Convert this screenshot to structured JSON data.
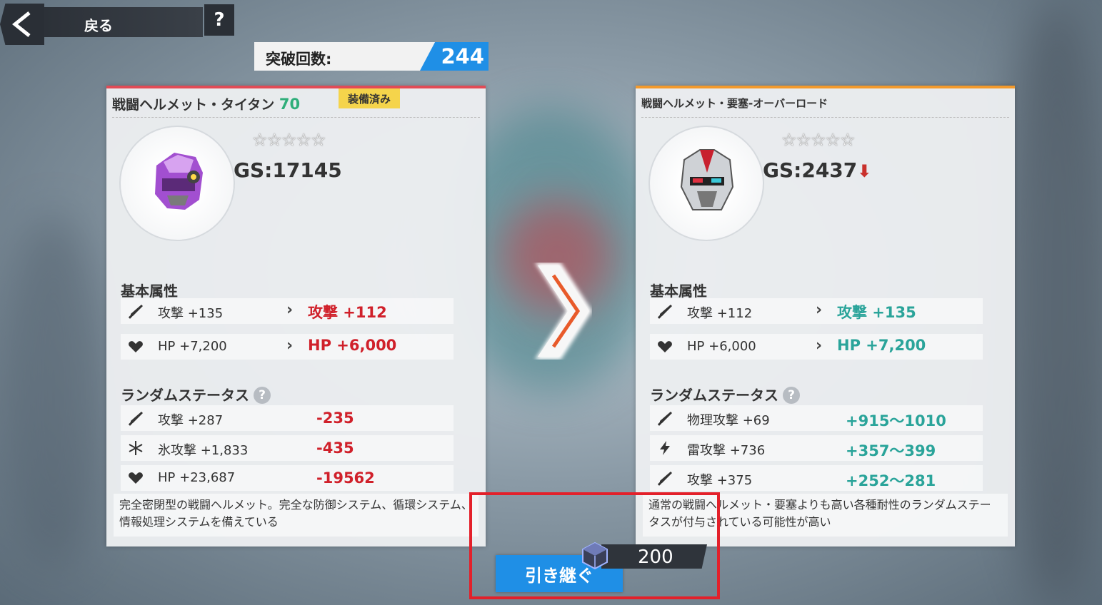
{
  "header": {
    "back_label": "戻る",
    "help_label": "?"
  },
  "breakthrough": {
    "label": "突破回数:",
    "value": "244"
  },
  "left_card": {
    "name": "戦闘ヘルメット・タイタン",
    "level": "70",
    "badge": "装備済み",
    "stars": "☆☆☆☆☆",
    "gs": "GS:17145",
    "basic_title": "基本属性",
    "basic": [
      {
        "icon": "sword-icon",
        "name": "攻撃 +135",
        "new_value": "攻撃 +112"
      },
      {
        "icon": "heart-icon",
        "name": "HP +7,200",
        "new_value": "HP +6,000"
      }
    ],
    "random_title": "ランダムステータス",
    "random": [
      {
        "icon": "sword-icon",
        "name": "攻撃 +287",
        "diff": "-235"
      },
      {
        "icon": "snowflake-icon",
        "name": "氷攻撃 +1,833",
        "diff": "-435"
      },
      {
        "icon": "heart-icon",
        "name": "HP +23,687",
        "diff": "-19562"
      }
    ],
    "description": "完全密閉型の戦闘ヘルメット。完全な防御システム、循環システム、情報処理システムを備えている"
  },
  "right_card": {
    "name": "戦闘ヘルメット・要塞-オーバーロード",
    "stars": "☆☆☆☆☆",
    "gs": "GS:2437",
    "gs_arrow": "⬇",
    "basic_title": "基本属性",
    "basic": [
      {
        "icon": "sword-icon",
        "name": "攻撃 +112",
        "new_value": "攻撃 +135"
      },
      {
        "icon": "heart-icon",
        "name": "HP +6,000",
        "new_value": "HP +7,200"
      }
    ],
    "random_title": "ランダムステータス",
    "random": [
      {
        "icon": "sword-icon",
        "name": "物理攻撃 +69",
        "diff": "+915～1010"
      },
      {
        "icon": "lightning-icon",
        "name": "雷攻撃 +736",
        "diff": "+357～399"
      },
      {
        "icon": "sword-icon",
        "name": "攻撃 +375",
        "diff": "+252～281"
      }
    ],
    "description": "通常の戦闘ヘルメット・要塞よりも高い各種耐性のランダムステータスが付与されている可能性が高い"
  },
  "footer": {
    "inherit_label": "引き継ぐ",
    "cost": "200"
  },
  "colors": {
    "accent_blue": "#1f8fe6",
    "decrease_red": "#d0202a",
    "increase_teal": "#2aa49a",
    "highlight": "#e3202a"
  }
}
